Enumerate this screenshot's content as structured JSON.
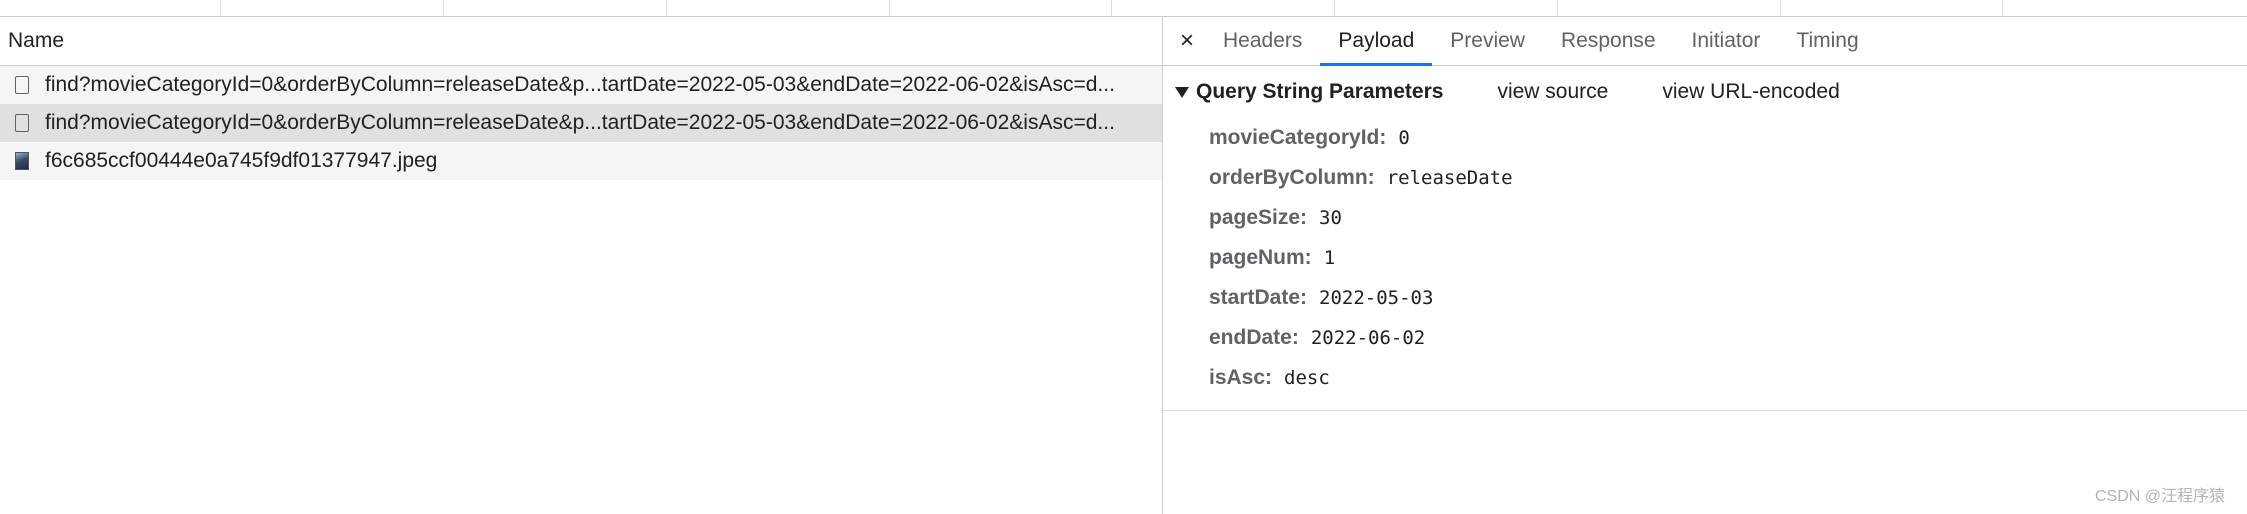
{
  "list": {
    "column_header": "Name",
    "requests": [
      {
        "name": "find?movieCategoryId=0&orderByColumn=releaseDate&p...tartDate=2022-05-03&endDate=2022-06-02&isAsc=d...",
        "icon": "document-icon"
      },
      {
        "name": "find?movieCategoryId=0&orderByColumn=releaseDate&p...tartDate=2022-05-03&endDate=2022-06-02&isAsc=d...",
        "icon": "document-icon"
      },
      {
        "name": "f6c685ccf00444e0a745f9df01377947.jpeg",
        "icon": "image-icon"
      }
    ]
  },
  "details": {
    "close_glyph": "×",
    "tabs": [
      {
        "label": "Headers"
      },
      {
        "label": "Payload",
        "active": true
      },
      {
        "label": "Preview"
      },
      {
        "label": "Response"
      },
      {
        "label": "Initiator"
      },
      {
        "label": "Timing"
      }
    ],
    "section": {
      "title": "Query String Parameters",
      "view_source": "view source",
      "view_url_encoded": "view URL-encoded",
      "params": [
        {
          "key": "movieCategoryId:",
          "value": "0"
        },
        {
          "key": "orderByColumn:",
          "value": "releaseDate"
        },
        {
          "key": "pageSize:",
          "value": "30"
        },
        {
          "key": "pageNum:",
          "value": "1"
        },
        {
          "key": "startDate:",
          "value": "2022-05-03"
        },
        {
          "key": "endDate:",
          "value": "2022-06-02"
        },
        {
          "key": "isAsc:",
          "value": "desc"
        }
      ]
    }
  },
  "watermark": "CSDN @汪程序猿",
  "colors": {
    "accent": "#1a73e8",
    "selected_row": "#e0e0e0",
    "border": "#cacdd1"
  }
}
